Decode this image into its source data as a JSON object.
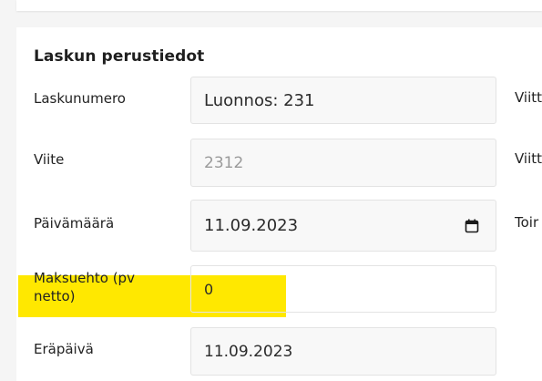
{
  "section": {
    "title": "Laskun perustiedot"
  },
  "fields": {
    "invoice_number": {
      "label": "Laskunumero",
      "value": "Luonnos: 231"
    },
    "reference": {
      "label": "Viite",
      "value": "2312"
    },
    "date": {
      "label": "Päivämäärä",
      "value": "11.09.2023"
    },
    "payment_terms": {
      "label_line1": "Maksuehto (pv",
      "label_line2": "netto)",
      "value": "0"
    },
    "due_date": {
      "label": "Eräpäivä",
      "value": "11.09.2023"
    }
  },
  "right_column": {
    "label1": "Viitt",
    "label2": "Viitt",
    "label3": "Toir"
  },
  "icons": {
    "calendar": "calendar-icon"
  },
  "colors": {
    "highlight": "#ffe800"
  }
}
